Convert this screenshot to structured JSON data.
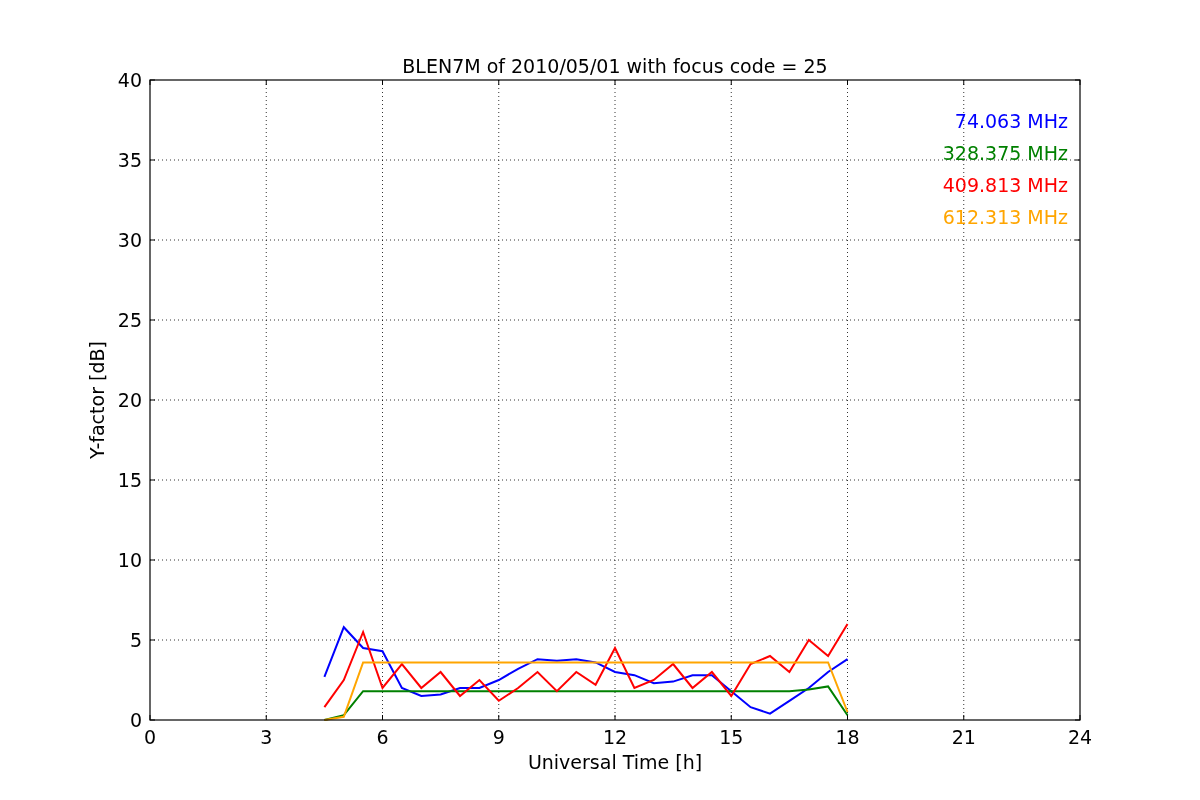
{
  "chart_data": {
    "type": "line",
    "title": "BLEN7M of 2010/05/01 with focus code = 25",
    "xlabel": "Universal Time [h]",
    "ylabel": "Y-factor [dB]",
    "x": [
      4.5,
      5,
      5.5,
      6,
      6.5,
      7,
      7.5,
      8,
      8.5,
      9,
      9.5,
      10,
      10.5,
      11,
      11.5,
      12,
      12.5,
      13,
      13.5,
      14,
      14.5,
      15,
      15.5,
      16,
      16.5,
      17,
      17.5,
      18
    ],
    "series": [
      {
        "name": "74.063 MHz",
        "color": "#0000ff",
        "values": [
          2.7,
          5.8,
          4.5,
          4.3,
          2.0,
          1.5,
          1.6,
          2.0,
          2.0,
          2.5,
          3.2,
          3.8,
          3.7,
          3.8,
          3.6,
          3.0,
          2.8,
          2.3,
          2.4,
          2.8,
          2.8,
          1.8,
          0.8,
          0.4,
          1.2,
          2.0,
          3.0,
          3.8
        ]
      },
      {
        "name": "328.375 MHz",
        "color": "#008000",
        "values": [
          0.0,
          0.3,
          1.8,
          1.8,
          1.8,
          1.8,
          1.8,
          1.8,
          1.8,
          1.8,
          1.8,
          1.8,
          1.8,
          1.8,
          1.8,
          1.8,
          1.8,
          1.8,
          1.8,
          1.8,
          1.8,
          1.8,
          1.8,
          1.8,
          1.8,
          1.9,
          2.1,
          0.3
        ]
      },
      {
        "name": "409.813 MHz",
        "color": "#ff0000",
        "values": [
          0.8,
          2.5,
          5.5,
          2.0,
          3.5,
          2.0,
          3.0,
          1.5,
          2.5,
          1.2,
          2.0,
          3.0,
          1.8,
          3.0,
          2.2,
          4.5,
          2.0,
          2.5,
          3.5,
          2.0,
          3.0,
          1.5,
          3.5,
          4.0,
          3.0,
          5.0,
          4.0,
          6.0
        ]
      },
      {
        "name": "612.313 MHz",
        "color": "#ffa500",
        "values": [
          0.0,
          0.2,
          3.6,
          3.6,
          3.6,
          3.6,
          3.6,
          3.6,
          3.6,
          3.6,
          3.6,
          3.6,
          3.6,
          3.6,
          3.6,
          3.6,
          3.6,
          3.6,
          3.6,
          3.6,
          3.6,
          3.6,
          3.6,
          3.6,
          3.6,
          3.6,
          3.6,
          0.5
        ]
      }
    ],
    "xlim": [
      0,
      24
    ],
    "ylim": [
      0,
      40
    ],
    "xticks": [
      0,
      3,
      6,
      9,
      12,
      15,
      18,
      21,
      24
    ],
    "yticks": [
      0,
      5,
      10,
      15,
      20,
      25,
      30,
      35,
      40
    ],
    "grid": true
  }
}
